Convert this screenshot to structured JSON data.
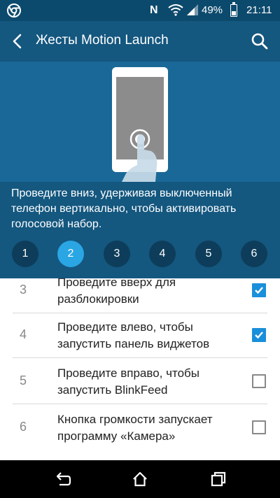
{
  "status_bar": {
    "battery_percent": "49%",
    "time": "21:11",
    "nfc_label": "N",
    "battery_level": 0.49,
    "icons": [
      "chrome-icon",
      "nfc-icon",
      "wifi-icon",
      "signal-icon",
      "battery-icon"
    ]
  },
  "app_bar": {
    "title": "Жесты Motion Launch"
  },
  "hero": {
    "description": "Проведите вниз, удерживая выключенный телефон вертикально, чтобы активировать голосовой набор."
  },
  "steps": {
    "items": [
      "1",
      "2",
      "3",
      "4",
      "5",
      "6"
    ],
    "active_index": 1
  },
  "gestures": [
    {
      "number": "3",
      "label": "Проведите вверх для разблокировки",
      "checked": true
    },
    {
      "number": "4",
      "label": "Проведите влево, чтобы запустить панель виджетов",
      "checked": true
    },
    {
      "number": "5",
      "label": "Проведите вправо, чтобы запустить BlinkFeed",
      "checked": false
    },
    {
      "number": "6",
      "label": "Кнопка громкости запускает программу «Камера»",
      "checked": false
    }
  ],
  "colors": {
    "status_bar": "#0c4a6d",
    "app_bar": "#14577f",
    "hero_bg": "#1a6897",
    "step_active": "#2aa6e4",
    "step_inactive": "#0d3d5a",
    "checkbox_checked": "#1a8fdb"
  },
  "nav_bar": {
    "icons": [
      "back-icon",
      "home-icon",
      "recents-icon"
    ]
  }
}
